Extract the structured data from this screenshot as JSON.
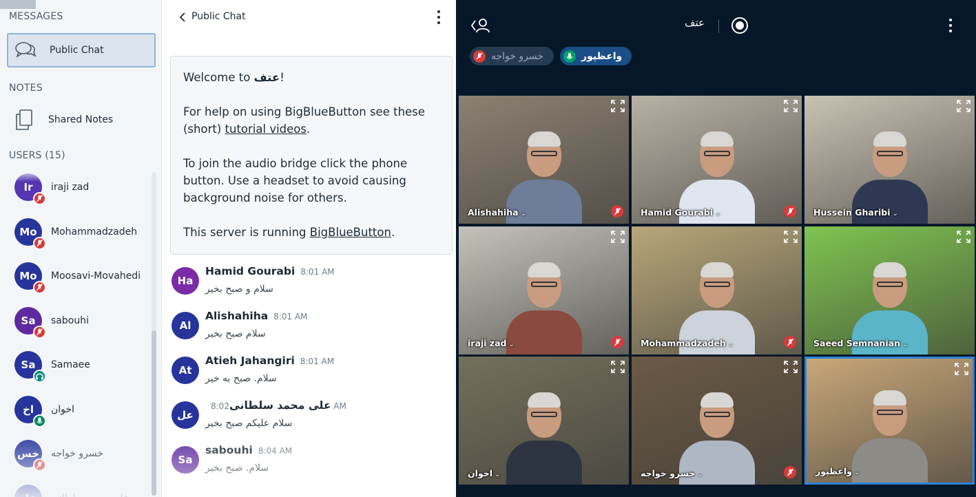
{
  "sidebar": {
    "messages_title": "MESSAGES",
    "public_chat_label": "Public Chat",
    "notes_title": "NOTES",
    "shared_notes_label": "Shared Notes",
    "users_title": "USERS (15)",
    "users": [
      {
        "initials": "Ir",
        "name": "iraji zad",
        "color": "#5535b1",
        "status": "muted"
      },
      {
        "initials": "Mo",
        "name": "Mohammadzadeh",
        "color": "#26349b",
        "status": "muted"
      },
      {
        "initials": "Mo",
        "name": "Moosavi-Movahedi",
        "color": "#26349b",
        "status": "muted"
      },
      {
        "initials": "Sa",
        "name": "sabouhi",
        "color": "#5f2aa0",
        "status": "muted"
      },
      {
        "initials": "Sa",
        "name": "Samaee",
        "color": "#26349b",
        "status": "listen"
      },
      {
        "initials": "اخ",
        "name": "اخوان",
        "color": "#26349b",
        "status": "mic"
      },
      {
        "initials": "خس",
        "name": "خسرو خواجه",
        "color": "#26349b",
        "status": "muted"
      },
      {
        "initials": "عل",
        "name": "علی محمد سلطانی",
        "color": "#26349b",
        "status": "muted"
      }
    ]
  },
  "chat": {
    "title": "Public Chat",
    "welcome": {
      "line1_prefix": "Welcome to ",
      "line1_name": "عتف",
      "line1_suffix": "!",
      "help_prefix": "For help on using BigBlueButton see these (short) ",
      "help_link": "tutorial videos",
      "help_suffix": ".",
      "audio_text": "To join the audio bridge click the phone button. Use a headset to avoid causing background noise for others.",
      "server_prefix": "This server is running ",
      "server_link": "BigBlueButton",
      "server_suffix": "."
    },
    "messages": [
      {
        "initials": "Ha",
        "color": "#7b2aa8",
        "name": "Hamid Gourabi",
        "time": "8:01 AM",
        "text": "سلام و صبح بخیر"
      },
      {
        "initials": "Al",
        "color": "#26349b",
        "name": "Alishahiha",
        "time": "8:01 AM",
        "text": "سلام صبح بخیر"
      },
      {
        "initials": "At",
        "color": "#26349b",
        "name": "Atieh Jahangiri",
        "time": "8:01 AM",
        "text": "سلام. صبح به خیر"
      },
      {
        "initials": "عل",
        "color": "#26349b",
        "name": "علی محمد سلطانی",
        "time": "8:02 AM",
        "text": "سلام علیکم صبح بخیر"
      },
      {
        "initials": "Sa",
        "color": "#5f2aa0",
        "name": "sabouhi",
        "time": "8:04 AM",
        "text": "سلام. صبح بخیر"
      }
    ]
  },
  "video": {
    "meeting_title": "عتف",
    "talkers": [
      {
        "name": "خسرو خواجه",
        "state": "muted"
      },
      {
        "name": "واعظپور",
        "state": "talking"
      }
    ],
    "tiles": [
      {
        "name": "Alishahiha",
        "muted": true,
        "bg": "#8c8172",
        "shirt": "#6d7d9a",
        "active": false
      },
      {
        "name": "Hamid Gourabi",
        "muted": true,
        "bg": "#b9b2a5",
        "shirt": "#dfe6ef",
        "active": false
      },
      {
        "name": "Hussein Gharibi",
        "muted": false,
        "bg": "#c9c3b4",
        "shirt": "#2f3852",
        "active": false
      },
      {
        "name": "iraji zad",
        "muted": true,
        "bg": "#c4c2bb",
        "shirt": "#8a4a3d",
        "active": false
      },
      {
        "name": "Mohammadzadeh",
        "muted": true,
        "bg": "#b8a77a",
        "shirt": "#cdd3db",
        "active": false
      },
      {
        "name": "Saeed Semnanian",
        "muted": false,
        "bg": "#7fc450",
        "shirt": "#5bb5c9",
        "active": false
      },
      {
        "name": "اخوان",
        "muted": false,
        "bg": "#74705c",
        "shirt": "#2b3440",
        "active": false
      },
      {
        "name": "خسرو خواجه",
        "muted": true,
        "bg": "#6b5a45",
        "shirt": "#aeb7c4",
        "active": false
      },
      {
        "name": "واعظپور",
        "muted": false,
        "bg": "#c9a779",
        "shirt": "#8d8b86",
        "active": true
      }
    ]
  },
  "colors": {
    "accent": "#2b84d8",
    "muted_red": "#d93a3a",
    "video_bg": "#06172a"
  }
}
